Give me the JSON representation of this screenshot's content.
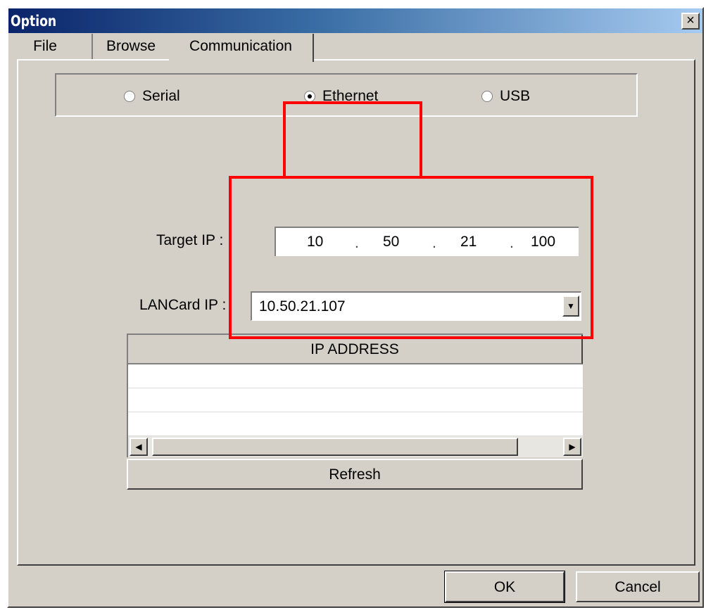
{
  "window": {
    "title": "Option",
    "close_glyph": "×"
  },
  "tabs": [
    {
      "label": "File"
    },
    {
      "label": "Browse"
    },
    {
      "label": "Communication",
      "active": true
    }
  ],
  "connection": {
    "options": [
      "Serial",
      "Ethernet",
      "USB"
    ],
    "selected": "Ethernet"
  },
  "target_ip": {
    "label": "Target IP :",
    "octets": [
      "10",
      "50",
      "21",
      "100"
    ],
    "separator": "."
  },
  "lancard_ip": {
    "label": "LANCard IP :",
    "value": "10.50.21.107"
  },
  "ip_list": {
    "header": "IP ADDRESS",
    "rows": [
      "",
      "",
      ""
    ]
  },
  "buttons": {
    "refresh": "Refresh",
    "ok": "OK",
    "cancel": "Cancel"
  },
  "icons": {
    "dropdown": "chevron-down-icon",
    "scroll_left": "scroll-left-icon",
    "scroll_right": "scroll-right-icon"
  },
  "colors": {
    "highlight": "#ff0000",
    "dialog_bg": "#d4d0c8",
    "title_start": "#0a246a",
    "title_end": "#a6caf0"
  }
}
